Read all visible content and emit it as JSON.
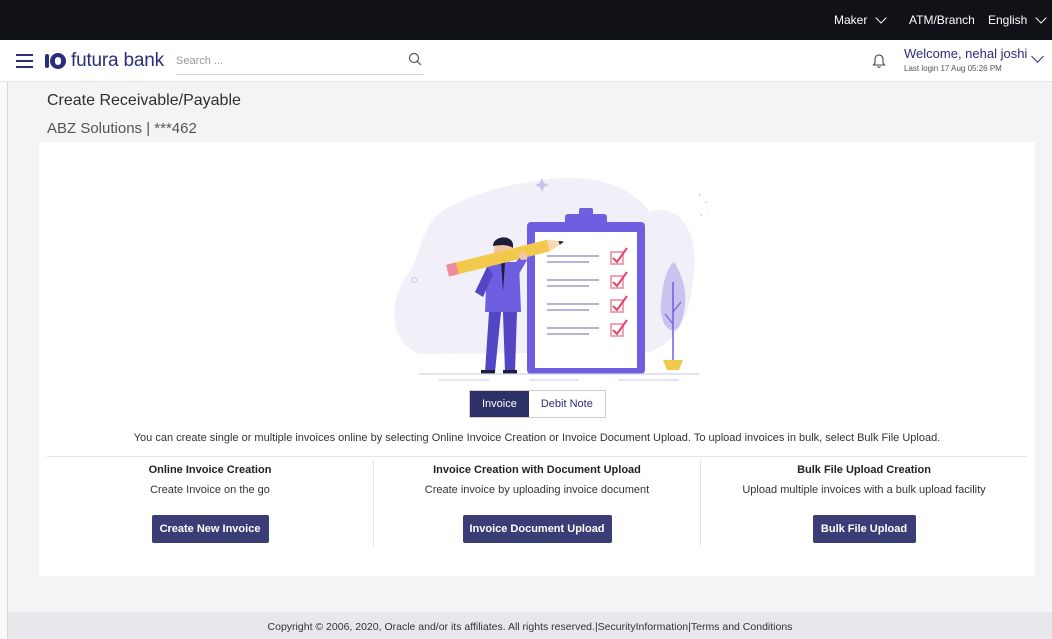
{
  "topbar": {
    "role": "Maker",
    "branch": "ATM/Branch",
    "language": "English"
  },
  "header": {
    "brand": "futura bank",
    "search_placeholder": "Search ...",
    "welcome": "Welcome, nehal joshi",
    "last_login": "Last login 17 Aug 05:26 PM"
  },
  "page": {
    "title": "Create Receivable/Payable",
    "subtitle": "ABZ Solutions | ***462"
  },
  "tabs": [
    {
      "label": "Invoice",
      "active": true
    },
    {
      "label": "Debit Note",
      "active": false
    }
  ],
  "info_text": "You can create single or multiple invoices online by selecting Online Invoice Creation or Invoice Document Upload. To upload invoices in bulk, select Bulk File Upload.",
  "options": [
    {
      "heading": "Online Invoice Creation",
      "description": "Create Invoice on the go",
      "button": "Create New Invoice"
    },
    {
      "heading": "Invoice Creation with Document Upload",
      "description": "Create invoice by uploading invoice document",
      "button": "Invoice Document Upload"
    },
    {
      "heading": "Bulk File Upload Creation",
      "description": "Upload multiple invoices with a bulk upload facility",
      "button": "Bulk File Upload"
    }
  ],
  "footer": {
    "copyright": "Copyright © 2006, 2020, Oracle and/or its affiliates. All rights reserved.",
    "security": "SecurityInformation",
    "terms": "Terms and Conditions"
  },
  "colors": {
    "brand": "#2b2d7a",
    "topbar": "#101218",
    "button": "#3b3d76",
    "illustration_purple": "#6e5fe0"
  },
  "icons": [
    "hamburger-menu-icon",
    "bank-logo-icon",
    "search-icon",
    "bell-icon",
    "chevron-down-icon"
  ]
}
